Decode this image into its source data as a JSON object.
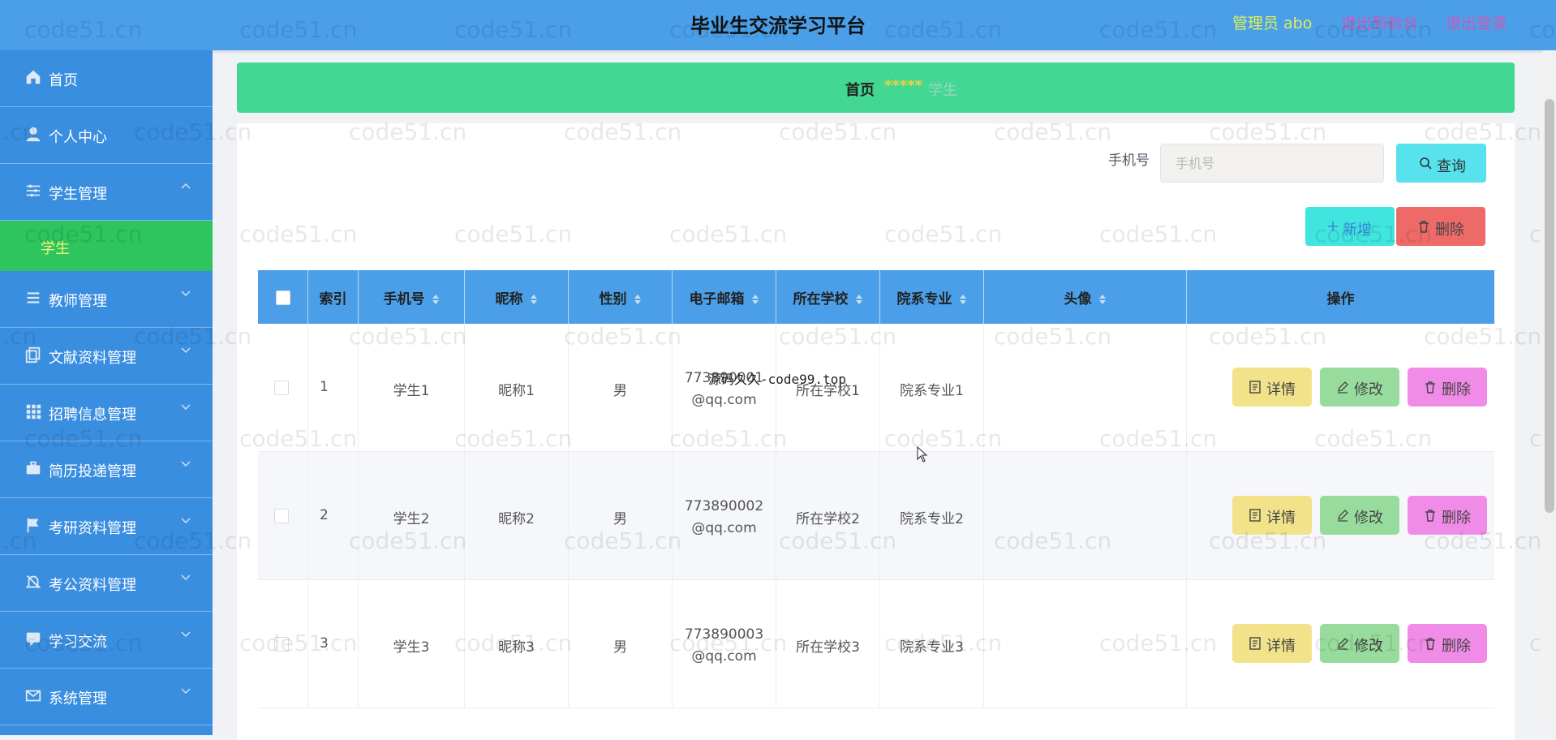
{
  "header": {
    "title": "毕业生交流学习平台",
    "admin_label": "管理员 abo",
    "back_label": "退出到前台",
    "logout_label": "退出登录",
    "colors": {
      "bar": "#4a9fe8",
      "admin": "#dff05a",
      "links": "#c95ab7"
    }
  },
  "sidebar": {
    "items": [
      {
        "label": "首页",
        "icon": "home-icon"
      },
      {
        "label": "个人中心",
        "icon": "user-icon"
      },
      {
        "label": "学生管理",
        "icon": "sliders-icon",
        "expanded": true
      },
      {
        "label": "教师管理",
        "icon": "list-icon"
      },
      {
        "label": "文献资料管理",
        "icon": "copy-icon"
      },
      {
        "label": "招聘信息管理",
        "icon": "grid-icon"
      },
      {
        "label": "简历投递管理",
        "icon": "briefcase-icon"
      },
      {
        "label": "考研资料管理",
        "icon": "flag-icon"
      },
      {
        "label": "考公资料管理",
        "icon": "bell-icon"
      },
      {
        "label": "学习交流",
        "icon": "chat-icon"
      },
      {
        "label": "系统管理",
        "icon": "mail-icon"
      }
    ],
    "active_sub": {
      "label": "学生",
      "color": "#2ec45e"
    }
  },
  "breadcrumb": {
    "home": "首页",
    "separator": "*****",
    "current": "学生"
  },
  "search": {
    "label": "手机号",
    "placeholder": "手机号",
    "value": "",
    "button_label": "查询"
  },
  "toolbar": {
    "add_label": "新增",
    "delete_label": "删除"
  },
  "table": {
    "columns": [
      "",
      "索引",
      "手机号",
      "昵称",
      "性别",
      "电子邮箱",
      "所在学校",
      "院系专业",
      "头像",
      "操作"
    ],
    "rows": [
      {
        "index": "1",
        "phone": "学生1",
        "nickname": "昵称1",
        "gender": "男",
        "email_line1": "773890001",
        "email_line2": "@qq.com",
        "school": "所在学校1",
        "major": "院系专业1"
      },
      {
        "index": "2",
        "phone": "学生2",
        "nickname": "昵称2",
        "gender": "男",
        "email_line1": "773890002",
        "email_line2": "@qq.com",
        "school": "所在学校2",
        "major": "院系专业2"
      },
      {
        "index": "3",
        "phone": "学生3",
        "nickname": "昵称3",
        "gender": "男",
        "email_line1": "773890003",
        "email_line2": "@qq.com",
        "school": "所在学校3",
        "major": "院系专业3"
      }
    ],
    "actions": {
      "detail": "详情",
      "edit": "修改",
      "delete": "删除"
    }
  },
  "overlay": {
    "text": "源码久久-code99.top"
  },
  "watermark": {
    "text": "code51.cn"
  }
}
